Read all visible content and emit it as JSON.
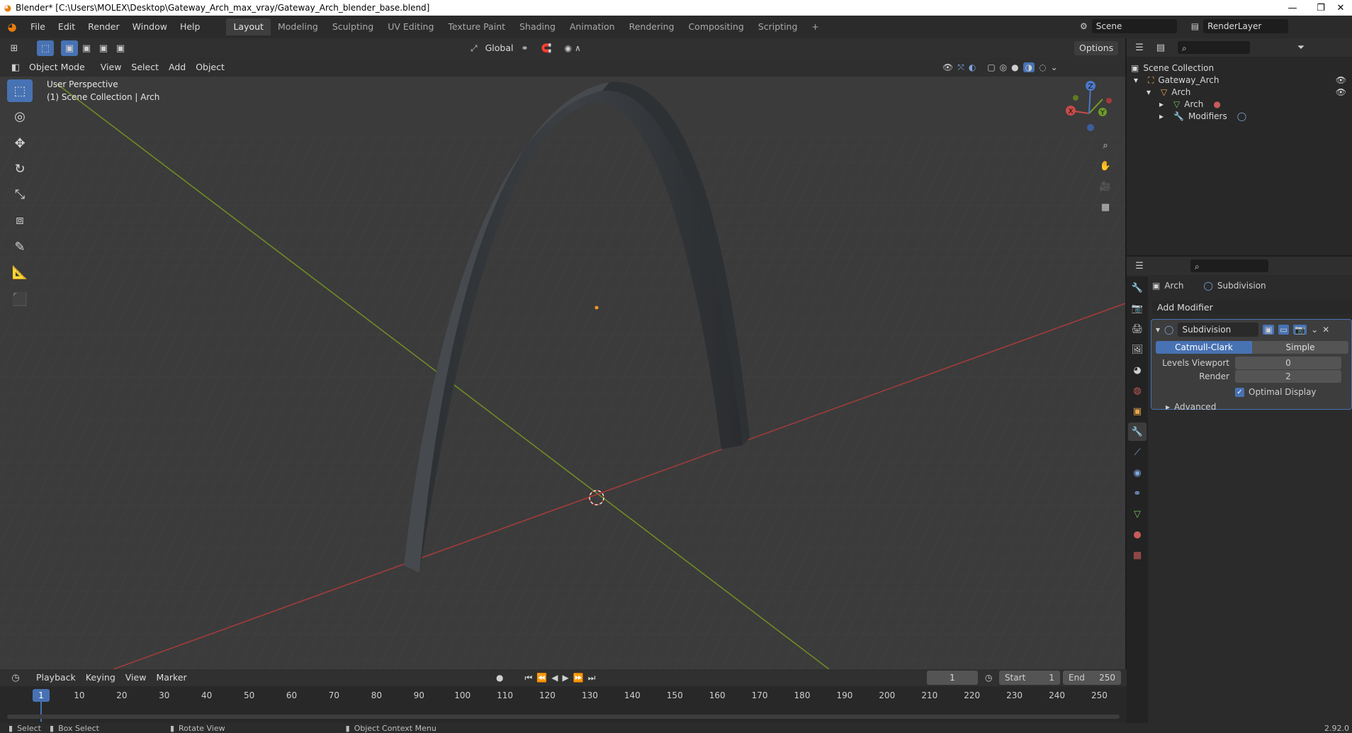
{
  "window": {
    "title": "Blender* [C:\\Users\\MOLEX\\Desktop\\Gateway_Arch_max_vray/Gateway_Arch_blender_base.blend]"
  },
  "menu": [
    "File",
    "Edit",
    "Render",
    "Window",
    "Help"
  ],
  "workspaces": [
    "Layout",
    "Modeling",
    "Sculpting",
    "UV Editing",
    "Texture Paint",
    "Shading",
    "Animation",
    "Rendering",
    "Compositing",
    "Scripting"
  ],
  "scene": {
    "name": "Scene",
    "view_layer": "RenderLayer"
  },
  "viewport_header": {
    "transform_orientation": "Global",
    "options_label": "Options",
    "mode": "Object Mode",
    "menus": [
      "View",
      "Select",
      "Add",
      "Object"
    ]
  },
  "viewport": {
    "perspective_label": "User Perspective",
    "collection_label": "(1) Scene Collection | Arch",
    "gizmo_axes": [
      "X",
      "Y",
      "Z"
    ]
  },
  "outliner": {
    "rows": [
      {
        "label": "Scene Collection"
      },
      {
        "label": "Gateway_Arch"
      },
      {
        "label": "Arch"
      },
      {
        "label": "Arch"
      },
      {
        "label": "Modifiers"
      }
    ]
  },
  "properties": {
    "breadcrumb_object": "Arch",
    "breadcrumb_modifier": "Subdivision",
    "add_modifier_label": "Add Modifier",
    "modifier": {
      "name": "Subdivision",
      "mode_options": [
        "Catmull-Clark",
        "Simple"
      ],
      "selected_mode": "Catmull-Clark",
      "levels_viewport_label": "Levels Viewport",
      "levels_viewport_value": "0",
      "render_label": "Render",
      "render_value": "2",
      "optimal_display_label": "Optimal Display",
      "optimal_display_checked": true,
      "advanced_label": "Advanced"
    }
  },
  "timeline": {
    "menus": [
      "Playback",
      "Keying",
      "View",
      "Marker"
    ],
    "current_frame": "1",
    "start_label": "Start",
    "start_value": "1",
    "end_label": "End",
    "end_value": "250",
    "ruler_ticks": [
      "1",
      "10",
      "20",
      "30",
      "40",
      "50",
      "60",
      "70",
      "80",
      "90",
      "100",
      "110",
      "120",
      "130",
      "140",
      "150",
      "160",
      "170",
      "180",
      "190",
      "200",
      "210",
      "220",
      "230",
      "240",
      "250"
    ]
  },
  "statusbar": {
    "items": [
      "Select",
      "Box Select",
      "Rotate View",
      "Object Context Menu"
    ],
    "version": "2.92.0"
  },
  "colors": {
    "accent": "#4772b3",
    "x_axis": "#a33b3b",
    "y_axis": "#6f8c25",
    "z_axis": "#4a78c8"
  }
}
